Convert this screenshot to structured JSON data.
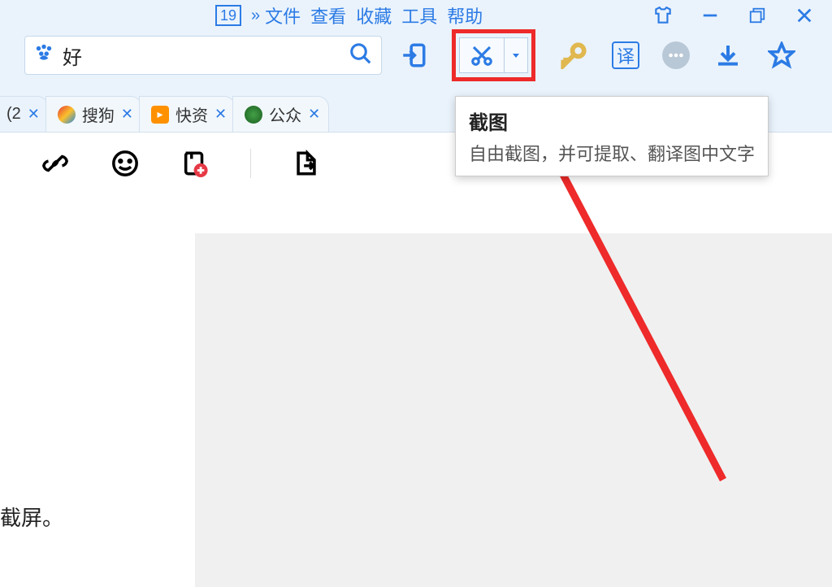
{
  "menu": {
    "date": "19",
    "items": [
      "文件",
      "查看",
      "收藏",
      "工具",
      "帮助"
    ]
  },
  "search": {
    "value": "好",
    "placeholder": ""
  },
  "toolbar": {
    "translate_label": "译"
  },
  "tabs": [
    {
      "label": "(2"
    },
    {
      "label": "搜狗"
    },
    {
      "label": "快资"
    },
    {
      "label": "公众"
    }
  ],
  "tooltip": {
    "title": "截图",
    "description": "自由截图，并可提取、翻译图中文字"
  },
  "content": {
    "bottom_text": "截屏。"
  }
}
